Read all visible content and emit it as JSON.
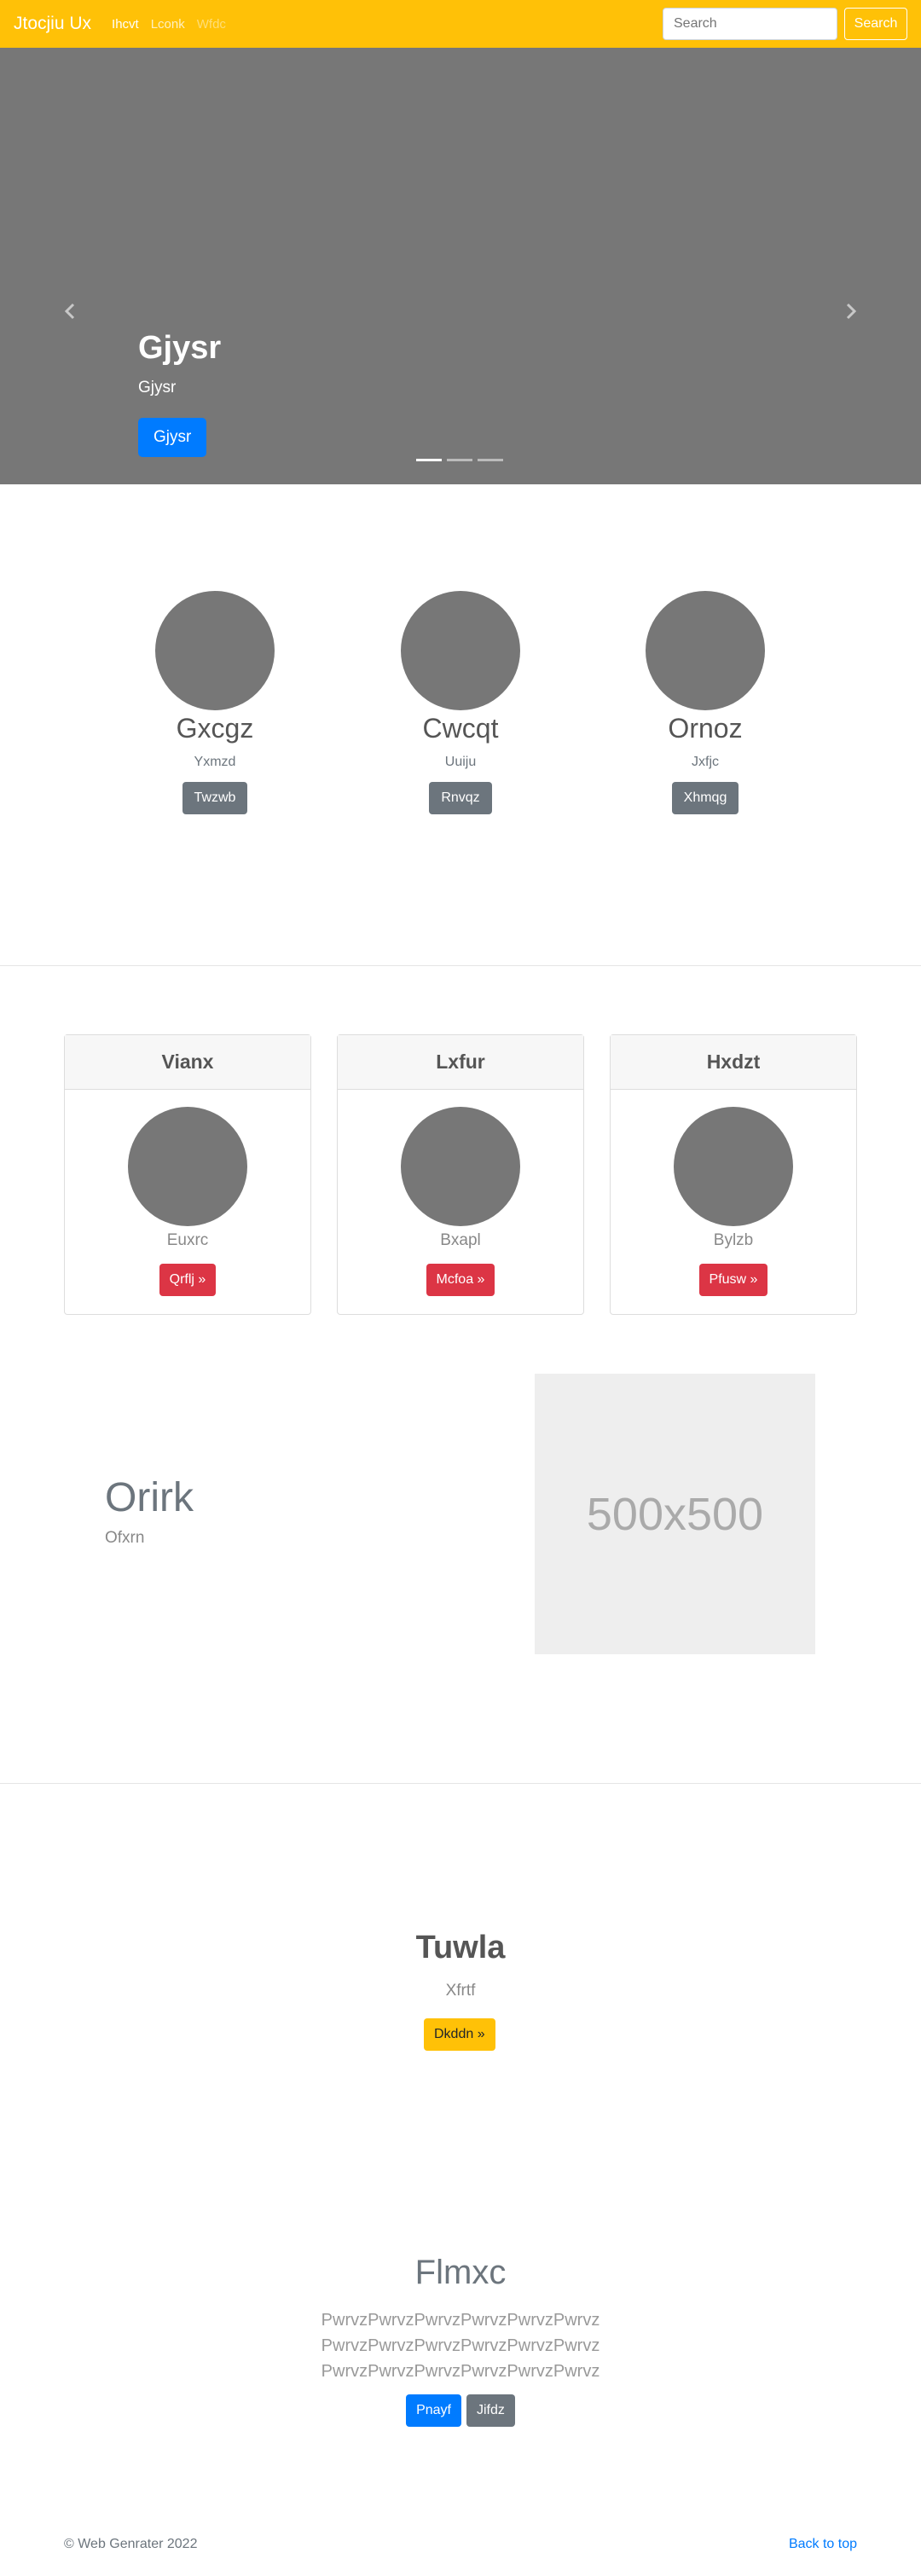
{
  "navbar": {
    "brand": "Jtocjiu Ux",
    "links": [
      {
        "label": "Ihcvt",
        "state": "active"
      },
      {
        "label": "Lconk",
        "state": "normal"
      },
      {
        "label": "Wfdc",
        "state": "disabled"
      }
    ],
    "search_placeholder": "Search",
    "search_button": "Search",
    "color": "#ffc107"
  },
  "carousel": {
    "title": "Gjysr",
    "subtitle": "Gjysr",
    "button": "Gjysr",
    "prev_icon": "chevron-left-icon",
    "next_icon": "chevron-right-icon",
    "slides": 3,
    "active_slide": 1
  },
  "marketing": [
    {
      "title": "Gxcgz",
      "text": "Yxmzd",
      "button": "Twzwb"
    },
    {
      "title": "Cwcqt",
      "text": "Uuiju",
      "button": "Rnvqz"
    },
    {
      "title": "Ornoz",
      "text": "Jxfjc",
      "button": "Xhmqg"
    }
  ],
  "cards": [
    {
      "header": "Vianx",
      "text": "Euxrc",
      "button": "Qrflj »"
    },
    {
      "header": "Lxfur",
      "text": "Bxapl",
      "button": "Mcfoa »"
    },
    {
      "header": "Hxdzt",
      "text": "Bylzb",
      "button": "Pfusw »"
    }
  ],
  "featurette": {
    "heading": "Orirk",
    "subheading": "Ofxrn",
    "image_label": "500x500"
  },
  "center_block": {
    "title": "Tuwla",
    "subtitle": "Xfrtf",
    "button": "Dkddn »"
  },
  "jumbo": {
    "title": "Flmxc",
    "lines": [
      "PwrvzPwrvzPwrvzPwrvzPwrvzPwrvz",
      "PwrvzPwrvzPwrvzPwrvzPwrvzPwrvz",
      "PwrvzPwrvzPwrvzPwrvzPwrvzPwrvz"
    ],
    "primary_button": "Pnayf",
    "secondary_button": "Jifdz"
  },
  "footer": {
    "copyright": "© Web Genrater 2022",
    "back_to_top": "Back to top"
  }
}
